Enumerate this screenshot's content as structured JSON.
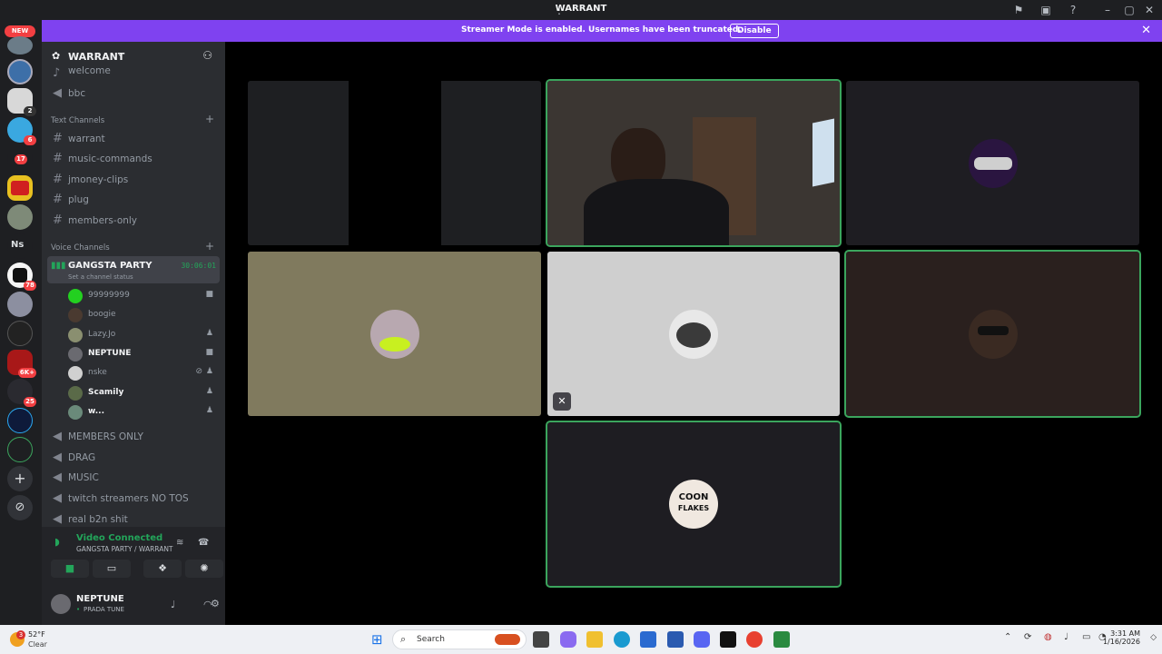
{
  "window": {
    "title": "WARRANT"
  },
  "banner": {
    "message": "Streamer Mode is enabled. Usernames have been truncated.",
    "button": "Disable"
  },
  "guilds": {
    "new_label": "NEW",
    "badges": [
      "2",
      "6",
      "17",
      "78",
      "6K+",
      "25"
    ],
    "text_guild": "Ns"
  },
  "server": {
    "name": "WARRANT"
  },
  "channels_top": [
    "welcome",
    "bbc"
  ],
  "text_category": "Text Channels",
  "text_channels": [
    "warrant",
    "music-commands",
    "jmoney-clips",
    "plug",
    "members-only"
  ],
  "voice_category": "Voice Channels",
  "active_voice": {
    "name": "GANGSTA PARTY",
    "timer": "30:06:01",
    "status_prompt": "Set a channel status"
  },
  "voice_users": [
    {
      "name": "99999999",
      "bold": false,
      "icon": "video-icon"
    },
    {
      "name": "boogie",
      "bold": false,
      "icon": ""
    },
    {
      "name": "Lazy.Jo",
      "bold": false,
      "icon": "game-icon"
    },
    {
      "name": "NEPTUNE",
      "bold": true,
      "icon": "video-icon"
    },
    {
      "name": "nske",
      "bold": false,
      "icon": "deafened-icon"
    },
    {
      "name": "Scamily",
      "bold": true,
      "icon": "game-icon"
    },
    {
      "name": "w...",
      "bold": true,
      "icon": "game-icon"
    }
  ],
  "voice_channels": [
    "MEMBERS ONLY",
    "DRAG",
    "MUSIC",
    "twitch streamers NO TOS",
    "real b2n shit"
  ],
  "voice_panel": {
    "status": "Video Connected",
    "location": "GANGSTA PARTY / WARRANT"
  },
  "user_panel": {
    "name": "NEPTUNE",
    "status": "PRADA TUNE"
  },
  "tile_avatar_text": {
    "line1": "COON",
    "line2": "FLAKES"
  },
  "taskbar": {
    "temp": "52°F",
    "condition": "Clear",
    "search_placeholder": "Search",
    "time": "3:31 AM",
    "date": "1/16/2026",
    "weather_badge": "3"
  },
  "colors": {
    "accent": "#7f42f0",
    "speaking": "#3ba55d",
    "online": "#23a55a"
  }
}
